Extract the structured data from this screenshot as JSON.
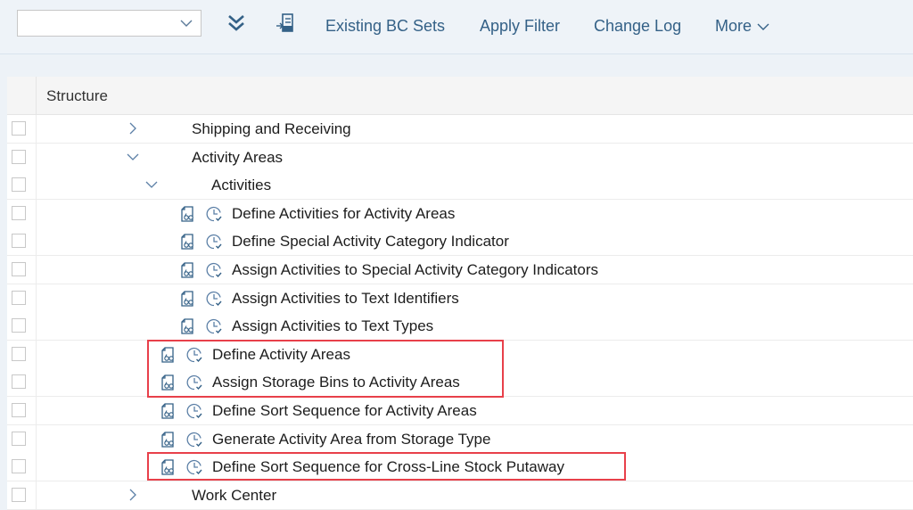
{
  "toolbar": {
    "select": {
      "value": "",
      "placeholder": ""
    },
    "icons": [
      "expand-all-icon",
      "import-icon"
    ],
    "buttons": {
      "existing_bc_sets": "Existing BC Sets",
      "apply_filter": "Apply Filter",
      "change_log": "Change Log",
      "more": "More"
    }
  },
  "table": {
    "header": "Structure",
    "rows": [
      {
        "label": "Shipping and Receiving",
        "type": "node",
        "expanded": false,
        "level": 1
      },
      {
        "label": "Activity Areas",
        "type": "node",
        "expanded": true,
        "level": 1
      },
      {
        "label": "Activities",
        "type": "node",
        "expanded": true,
        "level": 2
      },
      {
        "label": "Define Activities for Activity Areas",
        "type": "activity",
        "level": 3
      },
      {
        "label": "Define Special Activity Category Indicator",
        "type": "activity",
        "level": 3
      },
      {
        "label": "Assign Activities to Special Activity Category Indicators",
        "type": "activity",
        "level": 3
      },
      {
        "label": "Assign Activities to Text Identifiers",
        "type": "activity",
        "level": 3
      },
      {
        "label": "Assign Activities to Text Types",
        "type": "activity",
        "level": 3
      },
      {
        "label": "Define Activity Areas",
        "type": "activity",
        "level": 2,
        "highlighted": true
      },
      {
        "label": "Assign Storage Bins to Activity Areas",
        "type": "activity",
        "level": 2,
        "highlighted": true
      },
      {
        "label": "Define Sort Sequence for Activity Areas",
        "type": "activity",
        "level": 2
      },
      {
        "label": "Generate Activity Area from Storage Type",
        "type": "activity",
        "level": 2
      },
      {
        "label": "Define Sort Sequence for Cross-Line Stock Putaway",
        "type": "activity",
        "level": 2,
        "highlighted": true
      },
      {
        "label": "Work Center",
        "type": "node",
        "expanded": false,
        "level": 1
      }
    ]
  },
  "colors": {
    "accent": "#346187",
    "highlight": "#e8404a",
    "toolbar_bg": "#eef3f8",
    "header_bg": "#f5f5f5"
  }
}
